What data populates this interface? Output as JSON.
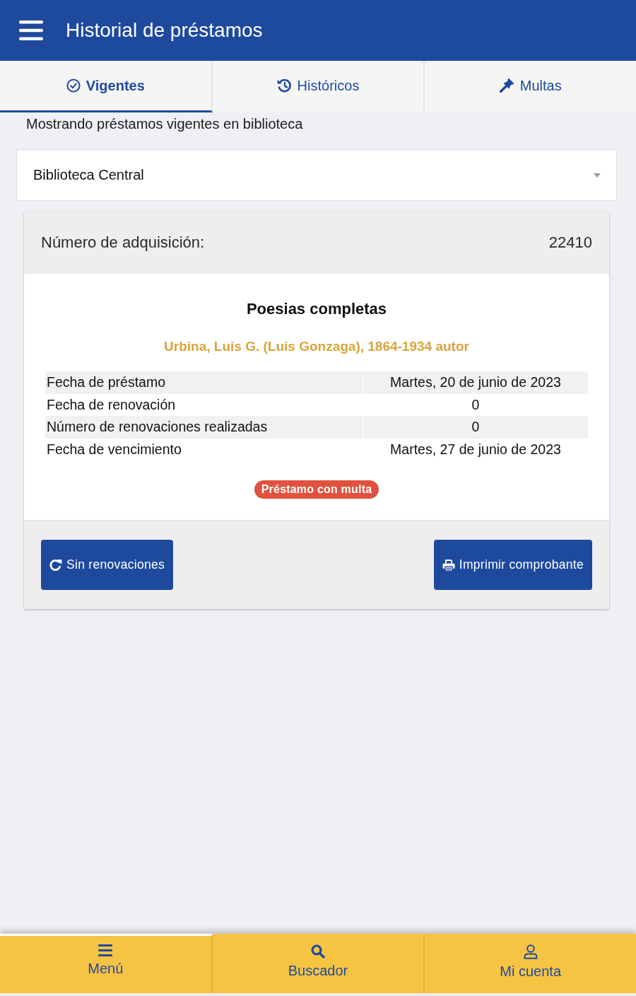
{
  "header": {
    "title": "Historial de préstamos"
  },
  "tabs": [
    {
      "label": "Vigentes",
      "selected": true,
      "kind": "check"
    },
    {
      "label": "Históricos",
      "selected": false,
      "kind": "history"
    },
    {
      "label": "Multas",
      "selected": false,
      "kind": "gavel"
    }
  ],
  "subtitle": "Mostrando préstamos vigentes en biblioteca",
  "library_select": {
    "value": "Biblioteca Central"
  },
  "loan": {
    "acquisition_label": "Número de adquisición:",
    "acquisition_number": "22410",
    "title": "Poesias completas",
    "author": "Urbina, Luis G. (Luis Gonzaga), 1864-1934 autor",
    "details": [
      {
        "label": "Fecha de préstamo",
        "value": "Martes, 20 de junio de 2023"
      },
      {
        "label": "Fecha de renovación",
        "value": "0"
      },
      {
        "label": "Número de renovaciones realizadas",
        "value": "0"
      },
      {
        "label": "Fecha de vencimiento",
        "value": "Martes, 27 de junio de 2023"
      }
    ],
    "badge": "Préstamo con multa",
    "buttons": [
      {
        "label": "Sin renovaciones",
        "kind": "renew"
      },
      {
        "label": "Imprimir comprobante",
        "kind": "print"
      }
    ]
  },
  "bottom_nav": [
    {
      "label": "Menú",
      "kind": "menu",
      "selected": true
    },
    {
      "label": "Buscador",
      "kind": "search",
      "selected": false
    },
    {
      "label": "Mi cuenta",
      "kind": "user",
      "selected": false
    }
  ]
}
